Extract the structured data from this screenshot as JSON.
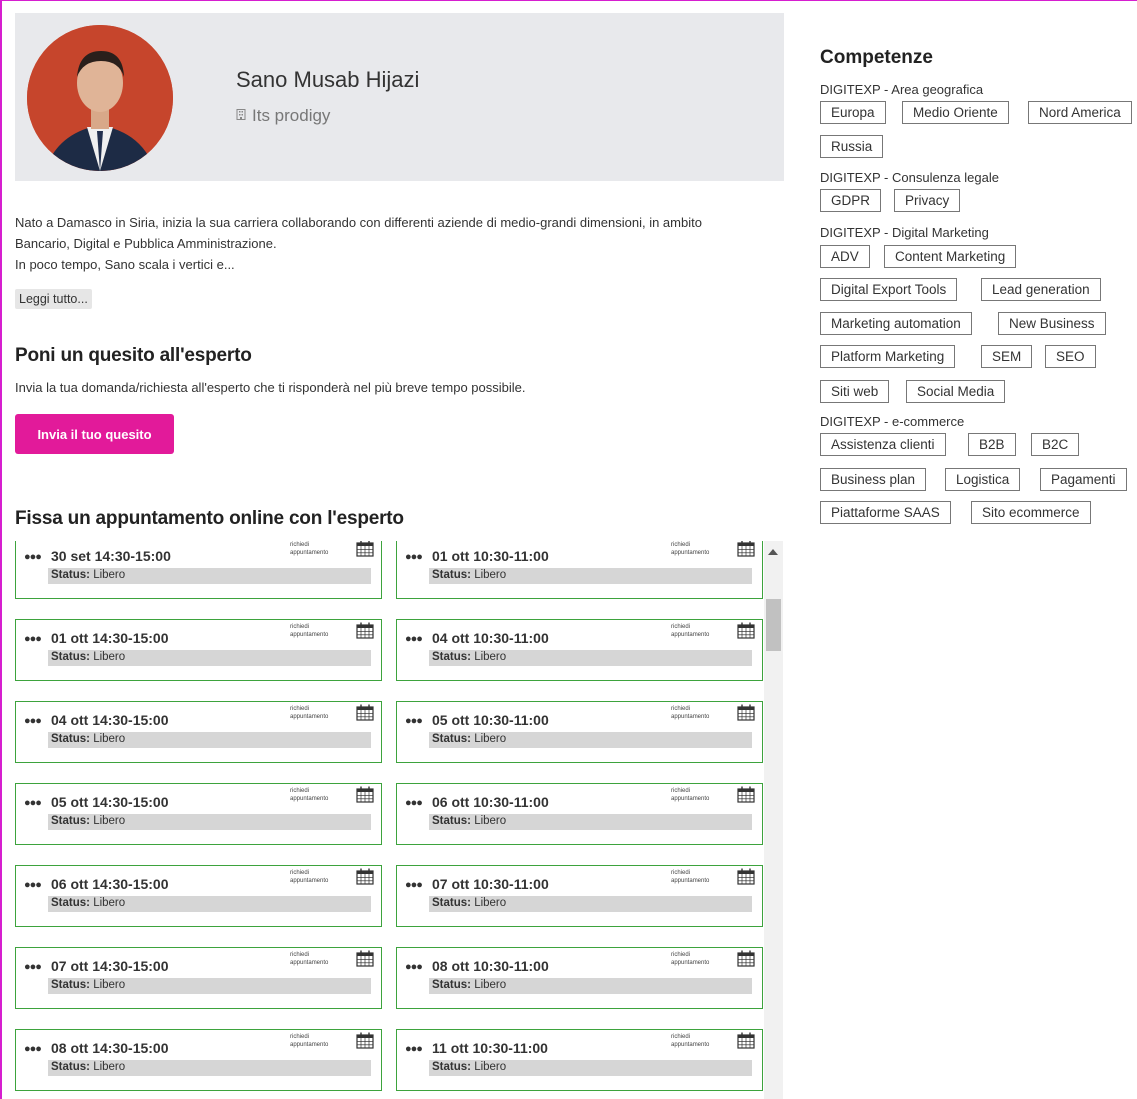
{
  "profile": {
    "name": "Sano Musab Hijazi",
    "company": "Its prodigy",
    "company_icon": "building-icon"
  },
  "bio": {
    "line1": "Nato a Damasco in Siria, inizia la sua carriera collaborando con differenti aziende di medio-grandi dimensioni, in ambito",
    "line2": "Bancario, Digital e Pubblica Amministrazione.",
    "line3": "In poco tempo, Sano scala i vertici e...",
    "read_more": "Leggi tutto..."
  },
  "ask": {
    "title": "Poni un quesito all'esperto",
    "description": "Invia la tua domanda/richiesta all'esperto che ti risponderà nel più breve tempo possibile.",
    "button": "Invia il tuo quesito"
  },
  "appointments": {
    "title": "Fissa un appuntamento online con l'esperto",
    "request_label": "richiedi appuntamento",
    "status_label": "Status:",
    "slots": [
      {
        "time": "30 set 14:30-15:00",
        "status": "Libero"
      },
      {
        "time": "01 ott 10:30-11:00",
        "status": "Libero"
      },
      {
        "time": "01 ott 14:30-15:00",
        "status": "Libero"
      },
      {
        "time": "04 ott 10:30-11:00",
        "status": "Libero"
      },
      {
        "time": "04 ott 14:30-15:00",
        "status": "Libero"
      },
      {
        "time": "05 ott 10:30-11:00",
        "status": "Libero"
      },
      {
        "time": "05 ott 14:30-15:00",
        "status": "Libero"
      },
      {
        "time": "06 ott 10:30-11:00",
        "status": "Libero"
      },
      {
        "time": "06 ott 14:30-15:00",
        "status": "Libero"
      },
      {
        "time": "07 ott 10:30-11:00",
        "status": "Libero"
      },
      {
        "time": "07 ott 14:30-15:00",
        "status": "Libero"
      },
      {
        "time": "08 ott 10:30-11:00",
        "status": "Libero"
      },
      {
        "time": "08 ott 14:30-15:00",
        "status": "Libero"
      },
      {
        "time": "11 ott 10:30-11:00",
        "status": "Libero"
      }
    ]
  },
  "competences": {
    "title": "Competenze",
    "categories": [
      {
        "name": "DIGITEXP - Area geografica",
        "tags": [
          "Europa",
          "Medio Oriente",
          "Nord America",
          "Russia"
        ]
      },
      {
        "name": "DIGITEXP - Consulenza legale",
        "tags": [
          "GDPR",
          "Privacy"
        ]
      },
      {
        "name": "DIGITEXP - Digital Marketing",
        "tags": [
          "ADV",
          "Content Marketing",
          "Digital Export Tools",
          "Lead generation",
          "Marketing automation",
          "New Business",
          "Platform Marketing",
          "SEM",
          "SEO",
          "Siti web",
          "Social Media"
        ]
      },
      {
        "name": "DIGITEXP - e-commerce",
        "tags": [
          "Assistenza clienti",
          "B2B",
          "B2C",
          "Business plan",
          "Logistica",
          "Pagamenti",
          "Piattaforme SAAS",
          "Sito ecommerce"
        ]
      }
    ]
  },
  "colors": {
    "accent": "#e21a9a",
    "slot_border": "#3da33d",
    "header_bg": "#e8e9ec"
  }
}
